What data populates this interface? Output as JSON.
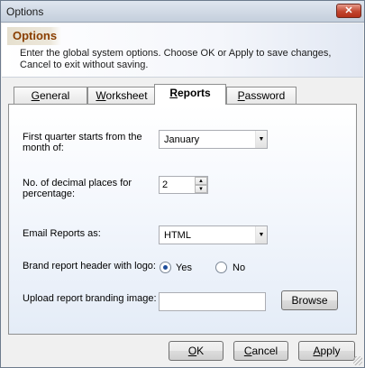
{
  "window": {
    "title": "Options",
    "close_symbol": "✕"
  },
  "header": {
    "title": "Options",
    "description": "Enter the global system options. Choose OK or Apply to save changes, Cancel to exit without saving."
  },
  "tabs": [
    {
      "label": "General",
      "ul": "G",
      "rest": "eneral",
      "active": false
    },
    {
      "label": "Worksheet",
      "ul": "W",
      "rest": "orksheet",
      "active": false
    },
    {
      "label": "Reports",
      "ul": "R",
      "rest": "eports",
      "active": true
    },
    {
      "label": "Password",
      "ul": "P",
      "rest": "assword",
      "active": false
    }
  ],
  "reports": {
    "first_quarter_label": "First quarter starts from the month of:",
    "first_quarter_value": "January",
    "decimal_label": "No. of decimal places for percentage:",
    "decimal_value": "2",
    "email_label": "Email Reports as:",
    "email_value": "HTML",
    "brand_label": "Brand report header with logo:",
    "brand_yes": "Yes",
    "brand_no": "No",
    "brand_selected": "Yes",
    "upload_label": "Upload report branding image:",
    "upload_value": "",
    "browse_label": "Browse"
  },
  "footer": {
    "ok": {
      "ul": "O",
      "rest": "K"
    },
    "cancel": {
      "ul": "C",
      "rest": "ancel"
    },
    "apply": {
      "ul": "A",
      "rest": "pply"
    }
  },
  "icons": {
    "dropdown": "▼",
    "spin_up": "▲",
    "spin_down": "▼"
  }
}
